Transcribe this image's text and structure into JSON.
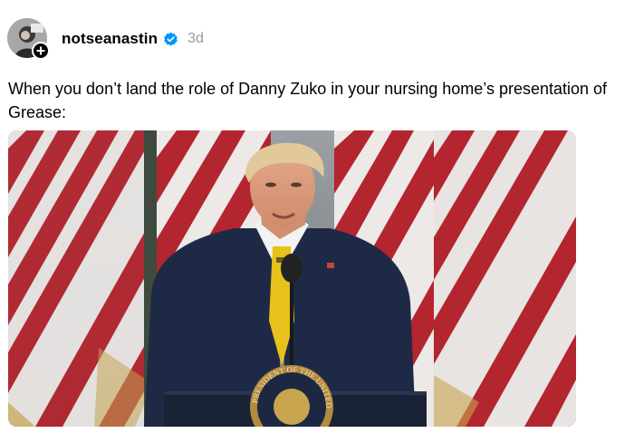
{
  "post": {
    "username": "notseanastin",
    "verified": true,
    "timestamp": "3d",
    "caption": "When you don’t land the role of Danny Zuko in your nursing home’s presentation of Grease:",
    "avatar_icon": "user-avatar",
    "follow_icon": "plus-icon",
    "verified_icon": "verified-badge-icon",
    "media": {
      "type": "video-still",
      "seal_text": "PRESIDENT OF THE UNITED"
    }
  },
  "colors": {
    "verified_blue": "#0095f6",
    "timestamp_gray": "#999999",
    "flag_red": "#b3252f",
    "suit_navy": "#1e2a45",
    "tie_yellow": "#e8c21a"
  }
}
